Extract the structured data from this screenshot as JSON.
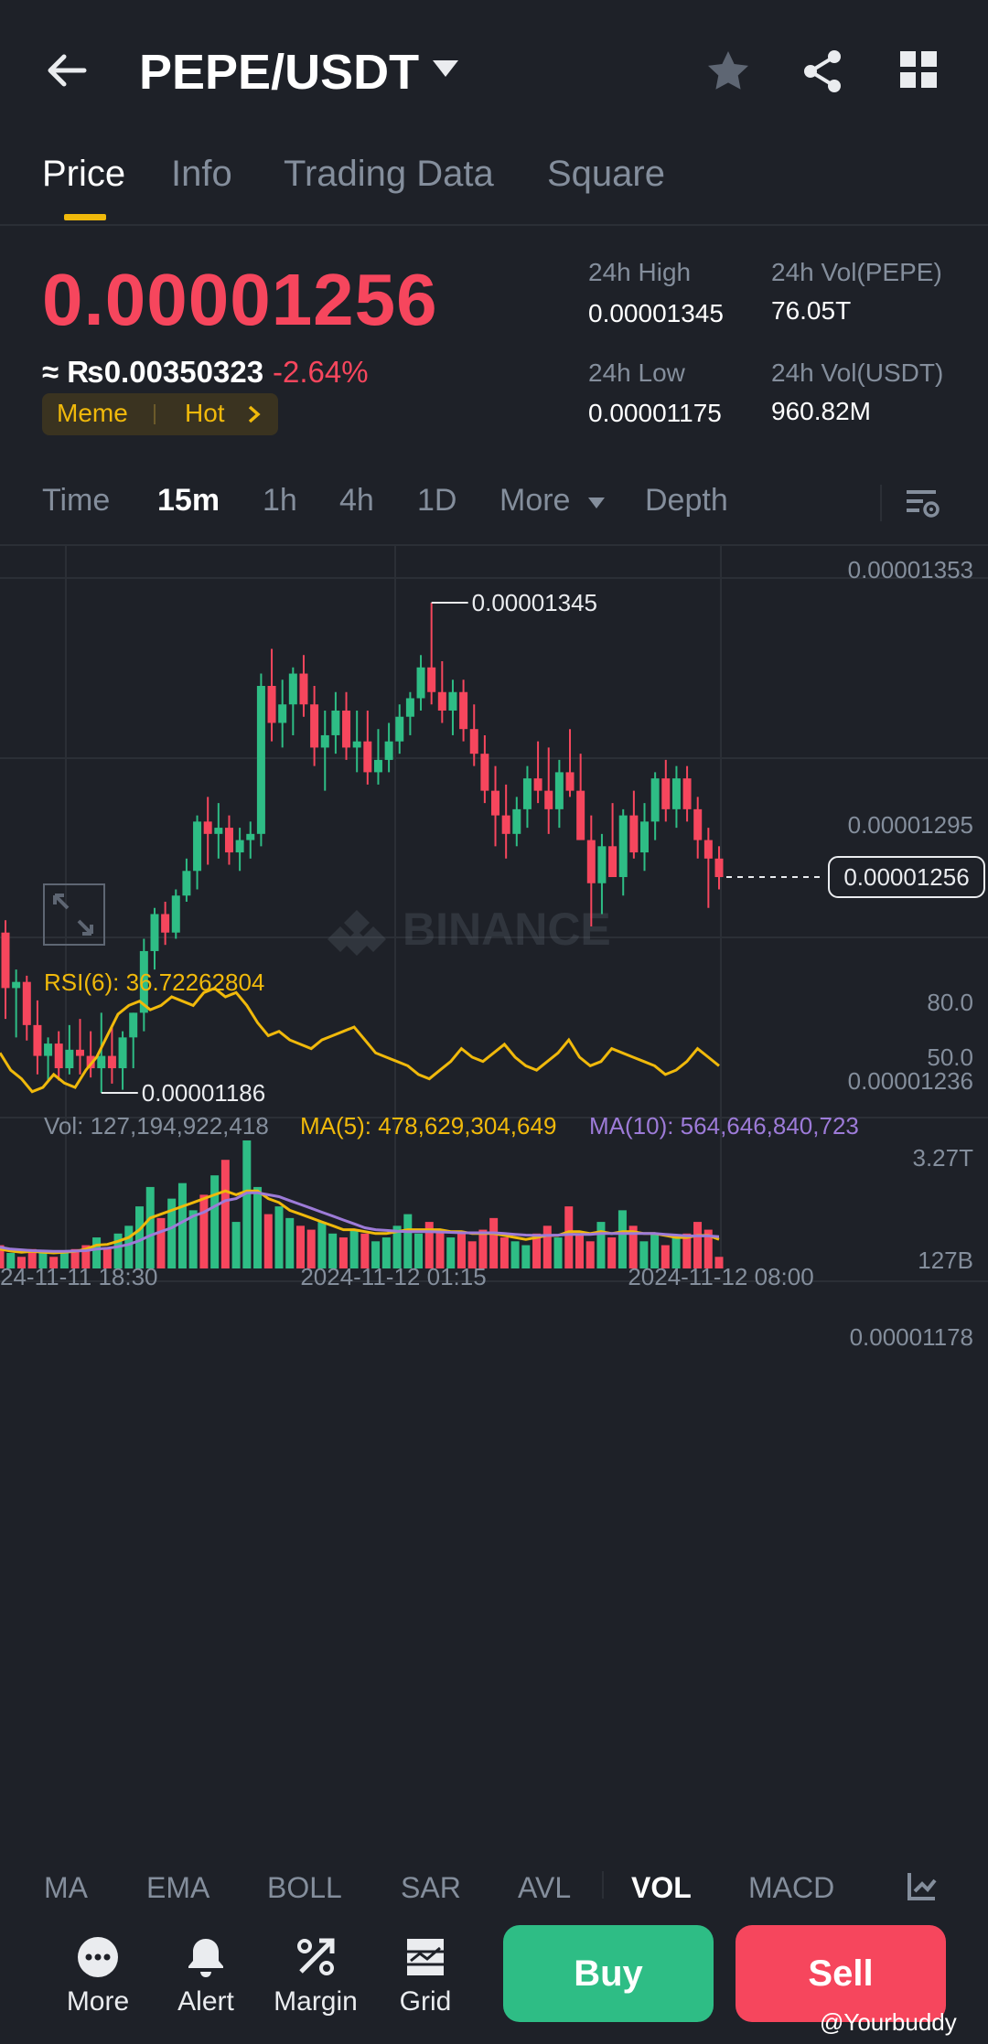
{
  "header": {
    "pair": "PEPE/USDT"
  },
  "tabs": [
    "Price",
    "Info",
    "Trading Data",
    "Square"
  ],
  "ticker": {
    "last_price": "0.00001256",
    "local_price": "≈ ₨0.00350323",
    "change_pct": "-2.64%",
    "tag1": "Meme",
    "tag2": "Hot",
    "high_label": "24h High",
    "high_value": "0.00001345",
    "low_label": "24h Low",
    "low_value": "0.00001175",
    "vol_base_label": "24h Vol(PEPE)",
    "vol_base_value": "76.05T",
    "vol_quote_label": "24h Vol(USDT)",
    "vol_quote_value": "960.82M"
  },
  "intervals": [
    "Time",
    "15m",
    "1h",
    "4h",
    "1D",
    "More",
    "Depth"
  ],
  "chart": {
    "price_ticks": [
      "0.00001353",
      "0.00001295",
      "0.00001236",
      "0.00001178"
    ],
    "current_price_tag": "0.00001256",
    "high_marker": "0.00001345",
    "low_marker": "0.00001186",
    "watermark": "BINANCE",
    "rsi_label": "RSI(6): 36.72262804",
    "rsi_ticks": [
      "80.0",
      "50.0"
    ],
    "vol_label": "Vol: 127,194,922,418",
    "ma5_label": "MA(5): 478,629,304,649",
    "ma10_label": "MA(10): 564,646,840,723",
    "vol_ticks": [
      "3.27T",
      "127B"
    ],
    "time_labels": [
      "24-11-11 18:30",
      "2024-11-12 01:15",
      "2024-11-12 08:00"
    ],
    "colors": {
      "up": "#2ebd85",
      "down": "#f6465d",
      "rsi": "#f0b90b",
      "ma10": "#9d7bd8",
      "grid": "#2b2f36"
    }
  },
  "chart_data": {
    "type": "candlestick",
    "title": "",
    "ylim": [
      1.178e-05,
      1.353e-05
    ],
    "candles": [
      {
        "o": 1.238e-05,
        "h": 1.242e-05,
        "l": 1.21e-05,
        "c": 1.22e-05
      },
      {
        "o": 1.22e-05,
        "h": 1.226e-05,
        "l": 1.204e-05,
        "c": 1.222e-05
      },
      {
        "o": 1.222e-05,
        "h": 1.224e-05,
        "l": 1.203e-05,
        "c": 1.208e-05
      },
      {
        "o": 1.208e-05,
        "h": 1.216e-05,
        "l": 1.192e-05,
        "c": 1.198e-05
      },
      {
        "o": 1.198e-05,
        "h": 1.204e-05,
        "l": 1.19e-05,
        "c": 1.202e-05
      },
      {
        "o": 1.202e-05,
        "h": 1.206e-05,
        "l": 1.19e-05,
        "c": 1.194e-05
      },
      {
        "o": 1.194e-05,
        "h": 1.208e-05,
        "l": 1.192e-05,
        "c": 1.2e-05
      },
      {
        "o": 1.2e-05,
        "h": 1.21e-05,
        "l": 1.192e-05,
        "c": 1.198e-05
      },
      {
        "o": 1.198e-05,
        "h": 1.206e-05,
        "l": 1.191e-05,
        "c": 1.194e-05
      },
      {
        "o": 1.194e-05,
        "h": 1.212e-05,
        "l": 1.186e-05,
        "c": 1.198e-05
      },
      {
        "o": 1.198e-05,
        "h": 1.208e-05,
        "l": 1.189e-05,
        "c": 1.194e-05
      },
      {
        "o": 1.194e-05,
        "h": 1.206e-05,
        "l": 1.187e-05,
        "c": 1.204e-05
      },
      {
        "o": 1.204e-05,
        "h": 1.212e-05,
        "l": 1.194e-05,
        "c": 1.212e-05
      },
      {
        "o": 1.212e-05,
        "h": 1.236e-05,
        "l": 1.206e-05,
        "c": 1.232e-05
      },
      {
        "o": 1.232e-05,
        "h": 1.246e-05,
        "l": 1.226e-05,
        "c": 1.244e-05
      },
      {
        "o": 1.244e-05,
        "h": 1.248e-05,
        "l": 1.234e-05,
        "c": 1.238e-05
      },
      {
        "o": 1.238e-05,
        "h": 1.252e-05,
        "l": 1.236e-05,
        "c": 1.25e-05
      },
      {
        "o": 1.25e-05,
        "h": 1.262e-05,
        "l": 1.248e-05,
        "c": 1.258e-05
      },
      {
        "o": 1.258e-05,
        "h": 1.276e-05,
        "l": 1.252e-05,
        "c": 1.274e-05
      },
      {
        "o": 1.274e-05,
        "h": 1.282e-05,
        "l": 1.26e-05,
        "c": 1.27e-05
      },
      {
        "o": 1.27e-05,
        "h": 1.28e-05,
        "l": 1.262e-05,
        "c": 1.272e-05
      },
      {
        "o": 1.272e-05,
        "h": 1.276e-05,
        "l": 1.26e-05,
        "c": 1.264e-05
      },
      {
        "o": 1.264e-05,
        "h": 1.272e-05,
        "l": 1.258e-05,
        "c": 1.268e-05
      },
      {
        "o": 1.268e-05,
        "h": 1.274e-05,
        "l": 1.262e-05,
        "c": 1.27e-05
      },
      {
        "o": 1.27e-05,
        "h": 1.322e-05,
        "l": 1.266e-05,
        "c": 1.318e-05
      },
      {
        "o": 1.318e-05,
        "h": 1.33e-05,
        "l": 1.3e-05,
        "c": 1.306e-05
      },
      {
        "o": 1.306e-05,
        "h": 1.32e-05,
        "l": 1.298e-05,
        "c": 1.312e-05
      },
      {
        "o": 1.312e-05,
        "h": 1.324e-05,
        "l": 1.302e-05,
        "c": 1.322e-05
      },
      {
        "o": 1.322e-05,
        "h": 1.328e-05,
        "l": 1.308e-05,
        "c": 1.312e-05
      },
      {
        "o": 1.312e-05,
        "h": 1.318e-05,
        "l": 1.292e-05,
        "c": 1.298e-05
      },
      {
        "o": 1.298e-05,
        "h": 1.31e-05,
        "l": 1.284e-05,
        "c": 1.302e-05
      },
      {
        "o": 1.302e-05,
        "h": 1.316e-05,
        "l": 1.296e-05,
        "c": 1.31e-05
      },
      {
        "o": 1.31e-05,
        "h": 1.316e-05,
        "l": 1.294e-05,
        "c": 1.298e-05
      },
      {
        "o": 1.298e-05,
        "h": 1.31e-05,
        "l": 1.29e-05,
        "c": 1.3e-05
      },
      {
        "o": 1.3e-05,
        "h": 1.31e-05,
        "l": 1.286e-05,
        "c": 1.29e-05
      },
      {
        "o": 1.29e-05,
        "h": 1.304e-05,
        "l": 1.286e-05,
        "c": 1.294e-05
      },
      {
        "o": 1.294e-05,
        "h": 1.306e-05,
        "l": 1.29e-05,
        "c": 1.3e-05
      },
      {
        "o": 1.3e-05,
        "h": 1.312e-05,
        "l": 1.296e-05,
        "c": 1.308e-05
      },
      {
        "o": 1.308e-05,
        "h": 1.316e-05,
        "l": 1.302e-05,
        "c": 1.314e-05
      },
      {
        "o": 1.314e-05,
        "h": 1.328e-05,
        "l": 1.31e-05,
        "c": 1.324e-05
      },
      {
        "o": 1.324e-05,
        "h": 1.345e-05,
        "l": 1.312e-05,
        "c": 1.316e-05
      },
      {
        "o": 1.316e-05,
        "h": 1.326e-05,
        "l": 1.306e-05,
        "c": 1.31e-05
      },
      {
        "o": 1.31e-05,
        "h": 1.32e-05,
        "l": 1.302e-05,
        "c": 1.316e-05
      },
      {
        "o": 1.316e-05,
        "h": 1.32e-05,
        "l": 1.3e-05,
        "c": 1.304e-05
      },
      {
        "o": 1.304e-05,
        "h": 1.312e-05,
        "l": 1.292e-05,
        "c": 1.296e-05
      },
      {
        "o": 1.296e-05,
        "h": 1.302e-05,
        "l": 1.28e-05,
        "c": 1.284e-05
      },
      {
        "o": 1.284e-05,
        "h": 1.292e-05,
        "l": 1.266e-05,
        "c": 1.276e-05
      },
      {
        "o": 1.276e-05,
        "h": 1.286e-05,
        "l": 1.262e-05,
        "c": 1.27e-05
      },
      {
        "o": 1.27e-05,
        "h": 1.282e-05,
        "l": 1.266e-05,
        "c": 1.278e-05
      },
      {
        "o": 1.278e-05,
        "h": 1.292e-05,
        "l": 1.272e-05,
        "c": 1.288e-05
      },
      {
        "o": 1.288e-05,
        "h": 1.3e-05,
        "l": 1.28e-05,
        "c": 1.284e-05
      },
      {
        "o": 1.284e-05,
        "h": 1.298e-05,
        "l": 1.27e-05,
        "c": 1.278e-05
      },
      {
        "o": 1.278e-05,
        "h": 1.294e-05,
        "l": 1.272e-05,
        "c": 1.29e-05
      },
      {
        "o": 1.29e-05,
        "h": 1.304e-05,
        "l": 1.282e-05,
        "c": 1.284e-05
      },
      {
        "o": 1.284e-05,
        "h": 1.296e-05,
        "l": 1.27e-05,
        "c": 1.268e-05
      },
      {
        "o": 1.268e-05,
        "h": 1.276e-05,
        "l": 1.24e-05,
        "c": 1.254e-05
      },
      {
        "o": 1.254e-05,
        "h": 1.27e-05,
        "l": 1.244e-05,
        "c": 1.266e-05
      },
      {
        "o": 1.266e-05,
        "h": 1.28e-05,
        "l": 1.26e-05,
        "c": 1.256e-05
      },
      {
        "o": 1.256e-05,
        "h": 1.278e-05,
        "l": 1.25e-05,
        "c": 1.276e-05
      },
      {
        "o": 1.276e-05,
        "h": 1.284e-05,
        "l": 1.262e-05,
        "c": 1.264e-05
      },
      {
        "o": 1.264e-05,
        "h": 1.28e-05,
        "l": 1.258e-05,
        "c": 1.274e-05
      },
      {
        "o": 1.274e-05,
        "h": 1.29e-05,
        "l": 1.268e-05,
        "c": 1.288e-05
      },
      {
        "o": 1.288e-05,
        "h": 1.294e-05,
        "l": 1.274e-05,
        "c": 1.278e-05
      },
      {
        "o": 1.278e-05,
        "h": 1.292e-05,
        "l": 1.272e-05,
        "c": 1.288e-05
      },
      {
        "o": 1.288e-05,
        "h": 1.292e-05,
        "l": 1.274e-05,
        "c": 1.278e-05
      },
      {
        "o": 1.278e-05,
        "h": 1.282e-05,
        "l": 1.262e-05,
        "c": 1.268e-05
      },
      {
        "o": 1.268e-05,
        "h": 1.272e-05,
        "l": 1.246e-05,
        "c": 1.262e-05
      },
      {
        "o": 1.262e-05,
        "h": 1.266e-05,
        "l": 1.252e-05,
        "c": 1.256e-05
      }
    ],
    "rsi": [
      50,
      42,
      38,
      32,
      34,
      40,
      36,
      34,
      42,
      48,
      58,
      68,
      72,
      74,
      70,
      72,
      76,
      74,
      72,
      78,
      80,
      76,
      78,
      72,
      64,
      58,
      60,
      56,
      54,
      52,
      56,
      58,
      60,
      62,
      56,
      50,
      48,
      46,
      44,
      40,
      38,
      42,
      46,
      52,
      48,
      46,
      50,
      54,
      48,
      44,
      42,
      46,
      50,
      56,
      48,
      44,
      46,
      52,
      50,
      48,
      46,
      44,
      40,
      42,
      46,
      52,
      48,
      44
    ],
    "volume": [
      0.6,
      0.4,
      0.3,
      0.5,
      0.4,
      0.3,
      0.4,
      0.5,
      0.6,
      0.8,
      0.5,
      0.9,
      1.1,
      1.6,
      2.1,
      1.3,
      1.8,
      2.2,
      1.5,
      1.9,
      2.4,
      2.8,
      1.2,
      3.3,
      2.1,
      1.4,
      1.6,
      1.3,
      1.1,
      1.0,
      1.2,
      0.9,
      0.8,
      1.0,
      0.9,
      0.7,
      0.8,
      1.1,
      1.4,
      0.9,
      1.2,
      1.0,
      0.8,
      0.9,
      0.7,
      1.0,
      1.3,
      0.8,
      0.7,
      0.6,
      0.9,
      1.1,
      0.8,
      1.6,
      0.9,
      0.7,
      1.2,
      0.8,
      1.5,
      1.1,
      0.7,
      0.9,
      0.6,
      0.8,
      0.9,
      1.2,
      1.0,
      0.3
    ],
    "ma5": [
      0.5,
      0.45,
      0.42,
      0.44,
      0.42,
      0.4,
      0.42,
      0.44,
      0.5,
      0.6,
      0.62,
      0.7,
      0.8,
      1.0,
      1.3,
      1.4,
      1.5,
      1.6,
      1.7,
      1.8,
      1.9,
      2.0,
      1.9,
      2.0,
      2.0,
      1.8,
      1.7,
      1.5,
      1.4,
      1.3,
      1.2,
      1.1,
      1.0,
      1.0,
      0.95,
      0.9,
      0.9,
      0.95,
      1.0,
      1.0,
      1.0,
      1.0,
      0.95,
      0.95,
      0.9,
      0.9,
      0.9,
      0.85,
      0.8,
      0.75,
      0.8,
      0.85,
      0.85,
      0.95,
      0.95,
      0.9,
      0.95,
      0.9,
      0.95,
      0.95,
      0.9,
      0.9,
      0.85,
      0.8,
      0.8,
      0.85,
      0.85,
      0.75
    ],
    "ma10": [
      0.55,
      0.5,
      0.48,
      0.46,
      0.45,
      0.44,
      0.44,
      0.45,
      0.46,
      0.5,
      0.52,
      0.56,
      0.62,
      0.72,
      0.85,
      0.95,
      1.05,
      1.2,
      1.35,
      1.45,
      1.6,
      1.75,
      1.8,
      1.95,
      1.95,
      1.9,
      1.85,
      1.75,
      1.65,
      1.55,
      1.45,
      1.35,
      1.25,
      1.15,
      1.05,
      1.0,
      0.98,
      0.96,
      0.95,
      0.95,
      0.95,
      0.94,
      0.93,
      0.92,
      0.92,
      0.92,
      0.92,
      0.9,
      0.88,
      0.86,
      0.85,
      0.85,
      0.86,
      0.88,
      0.88,
      0.88,
      0.9,
      0.9,
      0.9,
      0.9,
      0.9,
      0.9,
      0.88,
      0.86,
      0.84,
      0.84,
      0.84,
      0.82
    ]
  },
  "indicators": [
    "MA",
    "EMA",
    "BOLL",
    "SAR",
    "AVL",
    "VOL",
    "MACD"
  ],
  "bottom_nav": {
    "more": "More",
    "alert": "Alert",
    "margin": "Margin",
    "grid": "Grid",
    "buy": "Buy",
    "sell": "Sell"
  },
  "watermark_user": "@Yourbuddy"
}
